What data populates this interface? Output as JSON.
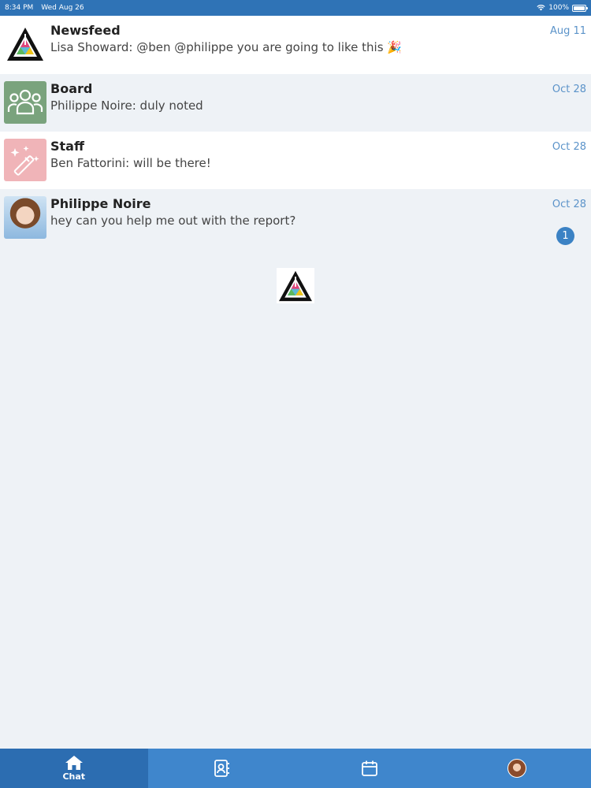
{
  "status_bar": {
    "time": "8:34 PM",
    "date": "Wed Aug 26",
    "battery": "100%",
    "wifi_icon": "wifi-icon",
    "battery_icon": "battery-icon"
  },
  "chats": [
    {
      "title": "Newsfeed",
      "preview": "Lisa Showard: @ben @philippe you are going to like this 🎉",
      "date": "Aug 11",
      "avatar": "logo"
    },
    {
      "title": "Board",
      "preview": "Philippe Noire: duly noted",
      "date": "Oct 28",
      "avatar": "group-icon"
    },
    {
      "title": "Staff",
      "preview": "Ben Fattorini: will be there!",
      "date": "Oct 28",
      "avatar": "magic-wand-icon"
    },
    {
      "title": "Philippe Noire",
      "preview": "hey can you help me out with the report?",
      "date": "Oct 28",
      "avatar": "photo",
      "unread": "1"
    }
  ],
  "tabs": [
    {
      "label": "Chat",
      "icon": "home-icon",
      "active": true
    },
    {
      "label": "",
      "icon": "contacts-icon",
      "active": false
    },
    {
      "label": "",
      "icon": "calendar-icon",
      "active": false
    },
    {
      "label": "",
      "icon": "profile-avatar",
      "active": false
    }
  ],
  "colors": {
    "accent": "#3f86cc",
    "active_tab": "#2c6db1",
    "status_bar": "#2f73b6",
    "date_text": "#5b93c9",
    "badge": "#3b82c4",
    "board_avatar": "#7aa37d",
    "staff_avatar": "#f0b4b8"
  }
}
